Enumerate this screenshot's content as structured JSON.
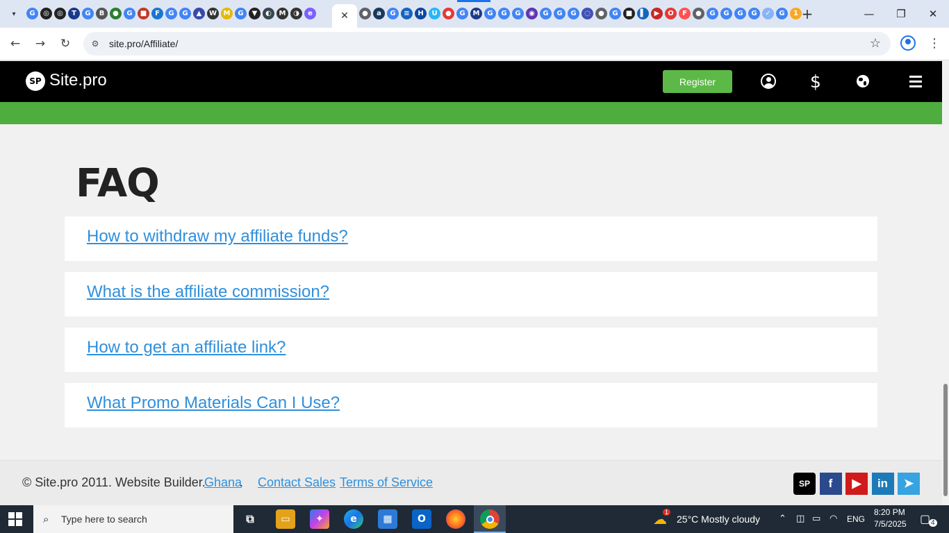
{
  "browser": {
    "url": "site.pro/Affiliate/",
    "tab_icons": [
      {
        "glyph": "G",
        "color": "#4285f4"
      },
      {
        "glyph": "◎",
        "color": "#222"
      },
      {
        "glyph": "◎",
        "color": "#222"
      },
      {
        "glyph": "T",
        "color": "#1a3a8a"
      },
      {
        "glyph": "G",
        "color": "#4285f4"
      },
      {
        "glyph": "B",
        "color": "#555"
      },
      {
        "glyph": "●",
        "color": "#2e7d32"
      },
      {
        "glyph": "G",
        "color": "#4285f4"
      },
      {
        "glyph": "■",
        "color": "#c0392b"
      },
      {
        "glyph": "F",
        "color": "#1976d2"
      },
      {
        "glyph": "G",
        "color": "#4285f4"
      },
      {
        "glyph": "G",
        "color": "#4285f4"
      },
      {
        "glyph": "▲",
        "color": "#3949ab"
      },
      {
        "glyph": "W",
        "color": "#333"
      },
      {
        "glyph": "M",
        "color": "#e6b800"
      },
      {
        "glyph": "G",
        "color": "#4285f4"
      },
      {
        "glyph": "▼",
        "color": "#222"
      },
      {
        "glyph": "◐",
        "color": "#37474f"
      },
      {
        "glyph": "M",
        "color": "#333"
      },
      {
        "glyph": "◑",
        "color": "#333"
      },
      {
        "glyph": "e",
        "color": "#7b61ff"
      }
    ],
    "tab_icons_right": [
      {
        "glyph": "●",
        "color": "#5f6368"
      },
      {
        "glyph": "a",
        "color": "#1a3a5c"
      },
      {
        "glyph": "G",
        "color": "#4285f4"
      },
      {
        "glyph": "≡",
        "color": "#1565c0"
      },
      {
        "glyph": "H",
        "color": "#0d47a1"
      },
      {
        "glyph": "U",
        "color": "#29b6f6"
      },
      {
        "glyph": "●",
        "color": "#e53935"
      },
      {
        "glyph": "G",
        "color": "#4285f4"
      },
      {
        "glyph": "M",
        "color": "#1a3a8a"
      },
      {
        "glyph": "G",
        "color": "#4285f4"
      },
      {
        "glyph": "G",
        "color": "#4285f4"
      },
      {
        "glyph": "G",
        "color": "#4285f4"
      },
      {
        "glyph": "◉",
        "color": "#5e35b1"
      },
      {
        "glyph": "G",
        "color": "#4285f4"
      },
      {
        "glyph": "G",
        "color": "#4285f4"
      },
      {
        "glyph": "G",
        "color": "#4285f4"
      },
      {
        "glyph": "◌",
        "color": "#3f51b5"
      },
      {
        "glyph": "●",
        "color": "#5f6368"
      },
      {
        "glyph": "G",
        "color": "#4285f4"
      },
      {
        "glyph": "■",
        "color": "#222"
      },
      {
        "glyph": "▌",
        "color": "#1565c0"
      },
      {
        "glyph": "▶",
        "color": "#c62828"
      },
      {
        "glyph": "O",
        "color": "#e53935"
      },
      {
        "glyph": "F",
        "color": "#ff5252"
      },
      {
        "glyph": "●",
        "color": "#5f6368"
      },
      {
        "glyph": "G",
        "color": "#4285f4"
      },
      {
        "glyph": "G",
        "color": "#4285f4"
      },
      {
        "glyph": "G",
        "color": "#4285f4"
      },
      {
        "glyph": "G",
        "color": "#4285f4"
      },
      {
        "glyph": "✓",
        "color": "#8ab4f8"
      },
      {
        "glyph": "G",
        "color": "#4285f4"
      },
      {
        "glyph": "1",
        "color": "#f9a825"
      }
    ],
    "active_tab_close": "✕",
    "new_tab": "+",
    "minimize": "—",
    "restore": "❐",
    "close": "✕",
    "back": "←",
    "forward": "→",
    "reload": "↻",
    "star": "☆",
    "kebab": "⋮"
  },
  "site": {
    "logo_badge": "SP",
    "logo_text": "Site.pro",
    "register_label": "Register",
    "dollar": "$"
  },
  "faq": {
    "title": "FAQ",
    "items": [
      "How to withdraw my affiliate funds?",
      "What is the affiliate commission?",
      "How to get an affiliate link?",
      "What Promo Materials Can I Use?"
    ]
  },
  "footer": {
    "copyright": "© Site.pro 2011. Website Builder.",
    "country": "Ghana",
    "dot": ".",
    "contact_sales": "Contact Sales",
    "terms": "Terms of Service",
    "social": [
      {
        "name": "sitepro",
        "glyph": "SP",
        "color": "#000000"
      },
      {
        "name": "facebook",
        "glyph": "f",
        "color": "#2a4a8c"
      },
      {
        "name": "youtube",
        "glyph": "▶",
        "color": "#d11a1a"
      },
      {
        "name": "linkedin",
        "glyph": "in",
        "color": "#1c7ab8"
      },
      {
        "name": "telegram",
        "glyph": "➤",
        "color": "#37a3e0"
      }
    ]
  },
  "taskbar": {
    "search_placeholder": "Type here to search",
    "weather": "25°C  Mostly cloudy",
    "weather_badge": "1",
    "language": "ENG",
    "time": "8:20 PM",
    "date": "7/5/2025",
    "notifications": "4"
  }
}
